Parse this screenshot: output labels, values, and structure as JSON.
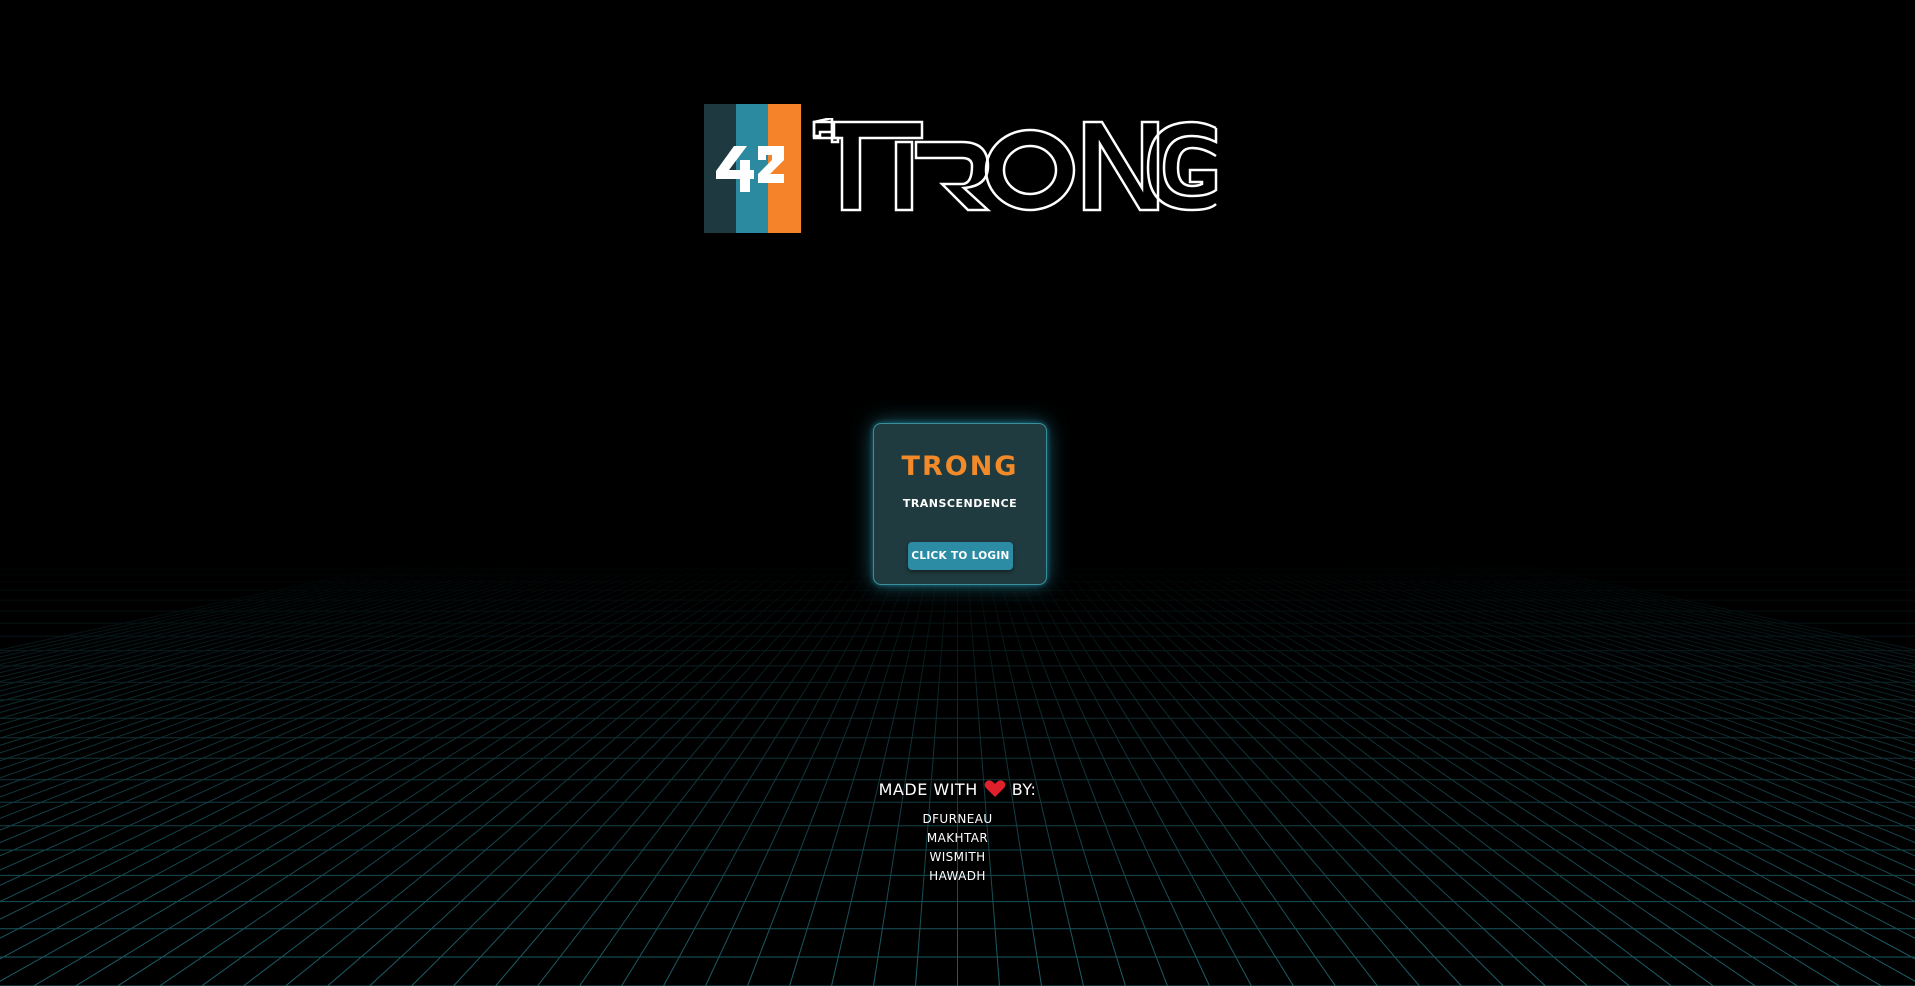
{
  "logo": {
    "badge_text": "42",
    "wordmark": "TRONG",
    "colors": {
      "dark_stripe": "#1e3a40",
      "mid_stripe": "#2b8aa0",
      "orange_stripe": "#f5832a"
    }
  },
  "card": {
    "title": "TRONG",
    "subtitle": "TRANSCENDENCE",
    "login_button": "CLICK TO LOGIN"
  },
  "credits": {
    "made_with": "MADE WITH",
    "by": "BY:",
    "heart_icon": "heart-icon",
    "authors": [
      "DFURNEAU",
      "MAKHTAR",
      "WISMITH",
      "HAWADH"
    ]
  },
  "colors": {
    "background": "#000000",
    "accent_orange": "#f28a2a",
    "accent_teal": "#2c8ca3",
    "card_bg": "#203b3f",
    "heart": "#e0202a",
    "grid": "#1f6a72"
  }
}
